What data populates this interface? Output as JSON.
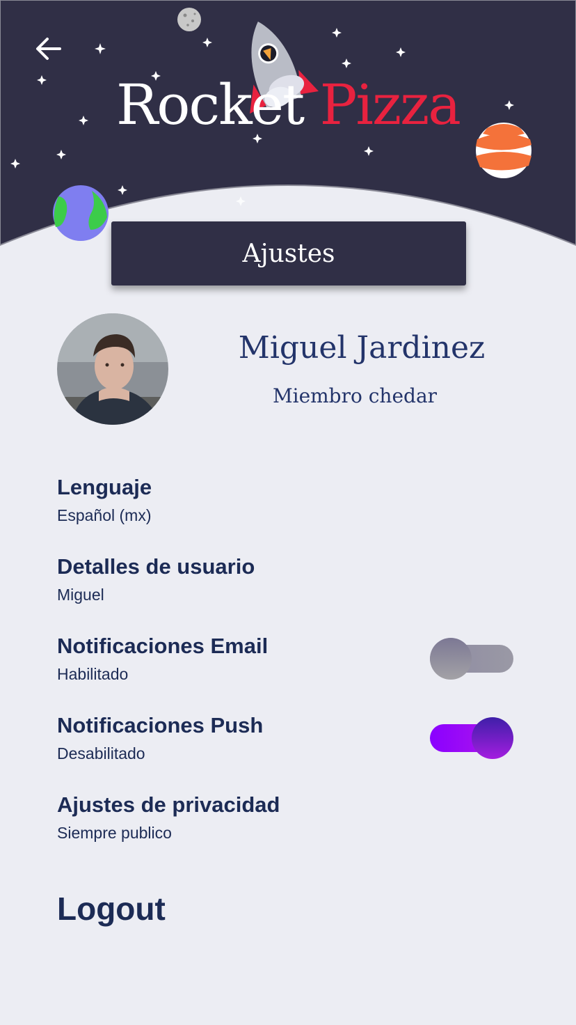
{
  "app": {
    "title_word1": "Rocket",
    "title_word2": "Pizza"
  },
  "header": {
    "section_title": "Ajustes"
  },
  "profile": {
    "name": "Miguel Jardinez",
    "tier": "Miembro chedar"
  },
  "settings": [
    {
      "label": "Lenguaje",
      "value": "Español (mx)"
    },
    {
      "label": "Detalles de usuario",
      "value": "Miguel"
    },
    {
      "label": "Notificaciones Email",
      "value": "Habilitado",
      "toggle": false
    },
    {
      "label": "Notificaciones Push",
      "value": "Desabilitado",
      "toggle": true
    },
    {
      "label": "Ajustes de privacidad",
      "value": "Siempre publico"
    }
  ],
  "logout_label": "Logout",
  "icons": {
    "back": "back-arrow-icon",
    "rocket": "rocket-icon",
    "moon": "moon-icon",
    "earth": "earth-planet-icon",
    "orange_planet": "orange-planet-icon"
  },
  "colors": {
    "header_bg": "#302f46",
    "page_bg": "#ecedf3",
    "accent_red": "#e8223f",
    "text_dark": "#1c2b55",
    "toggle_on": "#8a00ff"
  }
}
